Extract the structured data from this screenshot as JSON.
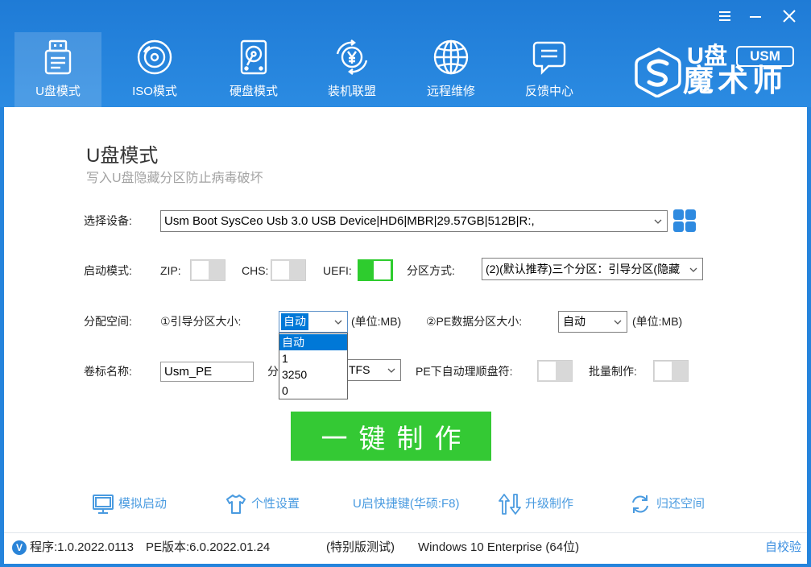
{
  "colors": {
    "header_blue": "#2584dc",
    "toggle_on": "#2ecc2e",
    "toggle_off": "#d8d8d8",
    "action_green": "#34c934",
    "link_blue": "#4a9be0",
    "list_highlight": "#0078d7"
  },
  "window_controls": [
    {
      "name": "menu",
      "icon": "menu-icon"
    },
    {
      "name": "minimize",
      "icon": "minimize-icon"
    },
    {
      "name": "close",
      "icon": "close-icon"
    }
  ],
  "nav": {
    "tabs": [
      {
        "label": "U盘模式",
        "icon": "usb-drive-icon",
        "selected": true
      },
      {
        "label": "ISO模式",
        "icon": "disc-icon",
        "selected": false
      },
      {
        "label": "硬盘模式",
        "icon": "hard-disk-icon",
        "selected": false
      },
      {
        "label": "装机联盟",
        "icon": "yen-coin-icon",
        "selected": false
      },
      {
        "label": "远程维修",
        "icon": "globe-icon",
        "selected": false
      },
      {
        "label": "反馈中心",
        "icon": "chat-bubble-icon",
        "selected": false
      }
    ]
  },
  "logo": {
    "prefix": "U盘",
    "badge": "USM",
    "name": "魔术师",
    "icon": "usm-s-logo-icon"
  },
  "main": {
    "title": "U盘模式",
    "subtitle": "写入U盘隐藏分区防止病毒破坏",
    "device": {
      "label": "选择设备:",
      "value": "Usm Boot SysCeo Usb 3.0 USB Device|HD6|MBR|29.57GB|512B|R:,",
      "button_icon": "grid-icon"
    },
    "boot": {
      "label": "启动模式:",
      "zip": {
        "label": "ZIP:",
        "on": false
      },
      "chs": {
        "label": "CHS:",
        "on": false
      },
      "uefi": {
        "label": "UEFI:",
        "on": true
      },
      "partition_scheme": {
        "label": "分区方式:",
        "value": "(2)(默认推荐)三个分区：引导分区(隐藏"
      }
    },
    "space": {
      "label": "分配空间:",
      "boot_size": {
        "label": "①引导分区大小:",
        "value": "自动",
        "focused": true,
        "unit": "(单位:MB)",
        "options": [
          {
            "label": "自动",
            "highlighted": true
          },
          {
            "label": "1",
            "highlighted": false
          },
          {
            "label": "3250",
            "highlighted": false
          },
          {
            "label": "0",
            "highlighted": false
          }
        ]
      },
      "pe_size": {
        "label": "②PE数据分区大小:",
        "value": "自动",
        "unit": "(单位:MB)"
      }
    },
    "volume": {
      "label": "卷标名称:",
      "value": "Usm_PE",
      "format_label": "分",
      "format_value": "TFS",
      "auto_letter": {
        "label": "PE下自动理顺盘符:",
        "on": false
      },
      "batch": {
        "label": "批量制作:",
        "on": false
      }
    },
    "action": {
      "label": "一键制作"
    }
  },
  "links": [
    {
      "label": "模拟启动",
      "icon": "monitor-icon"
    },
    {
      "label": "个性设置",
      "icon": "tshirt-icon"
    },
    {
      "label": "U启快捷键(华硕:F8)"
    },
    {
      "label": "升级制作",
      "icon": "up-down-arrows-icon"
    },
    {
      "label": "归还空间",
      "icon": "refresh-icon"
    }
  ],
  "status": {
    "badge": "V",
    "program": "程序:1.0.2022.0113",
    "pe_version": "PE版本:6.0.2022.01.24",
    "edition": "(特别版测试)",
    "os": "Windows 10 Enterprise (64位)",
    "self_check": "自校验"
  }
}
